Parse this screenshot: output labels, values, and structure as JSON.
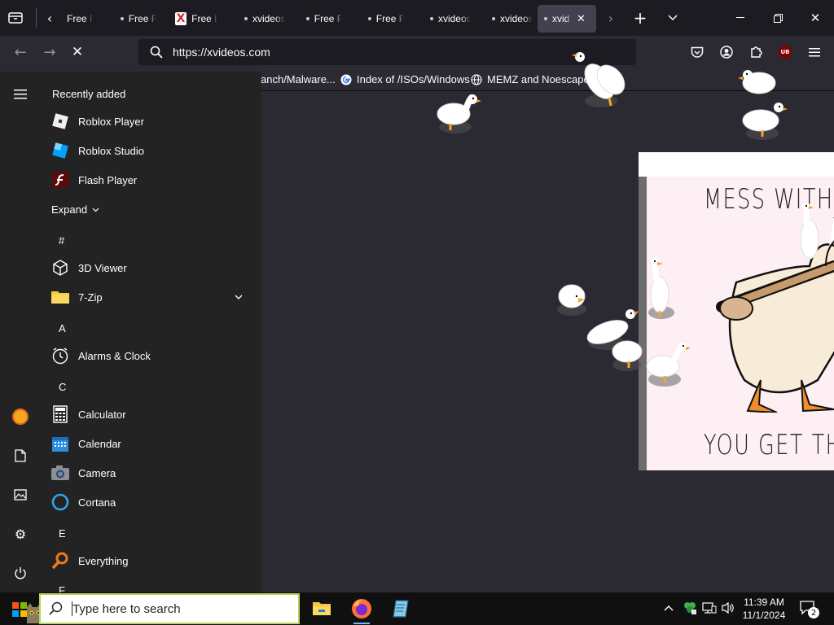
{
  "browser": {
    "tabs": [
      {
        "title": "Free P",
        "has_dot": false,
        "favicon": "tab-page-icon"
      },
      {
        "title": "Free P",
        "has_dot": true
      },
      {
        "title": "Free P",
        "has_dot": false,
        "favicon": "x-logo-icon"
      },
      {
        "title": "xvideos",
        "has_dot": true
      },
      {
        "title": "Free P",
        "has_dot": true
      },
      {
        "title": "Free P",
        "has_dot": true
      },
      {
        "title": "xvideos",
        "has_dot": true
      },
      {
        "title": "xvideos",
        "has_dot": true
      },
      {
        "title": "xvid",
        "has_dot": true,
        "active": true
      }
    ],
    "url": "https://xvideos.com",
    "bookmarks": [
      {
        "label": "anch/Malware..."
      },
      {
        "label": "Index of /ISOs/Windows",
        "icon": "google-icon"
      },
      {
        "label": "MEMZ and Noescape ...",
        "icon": "globe-icon"
      }
    ],
    "extension_badge": "UB"
  },
  "meme": {
    "top_text": "MESS WITH THE",
    "bottom_text": "YOU GET THE"
  },
  "start_menu": {
    "recently_added_label": "Recently added",
    "recent_apps": [
      {
        "name": "Roblox Player",
        "icon": "roblox-player-icon"
      },
      {
        "name": "Roblox Studio",
        "icon": "roblox-studio-icon"
      },
      {
        "name": "Flash Player",
        "icon": "flash-player-icon"
      }
    ],
    "expand_label": "Expand",
    "groups": [
      {
        "letter": "#",
        "apps": [
          {
            "name": "3D Viewer",
            "icon": "cube-icon"
          },
          {
            "name": "7-Zip",
            "icon": "folder-icon",
            "expandable": true
          }
        ]
      },
      {
        "letter": "A",
        "apps": [
          {
            "name": "Alarms & Clock",
            "icon": "clock-icon"
          }
        ]
      },
      {
        "letter": "C",
        "apps": [
          {
            "name": "Calculator",
            "icon": "calculator-icon"
          },
          {
            "name": "Calendar",
            "icon": "calendar-icon"
          },
          {
            "name": "Camera",
            "icon": "camera-icon"
          },
          {
            "name": "Cortana",
            "icon": "cortana-icon"
          }
        ]
      },
      {
        "letter": "E",
        "apps": [
          {
            "name": "Everything",
            "icon": "magnifier-icon"
          }
        ]
      },
      {
        "letter": "F",
        "apps": []
      }
    ]
  },
  "taskbar": {
    "search_placeholder": "Type here to search",
    "time": "11:39 AM",
    "date": "11/1/2024",
    "notification_count": "2"
  },
  "colors": {
    "accent_search_border": "#b6d45a",
    "firefox_orange": "#ff7139",
    "taskbar_bg": "#101010",
    "start_bg": "#232323"
  }
}
